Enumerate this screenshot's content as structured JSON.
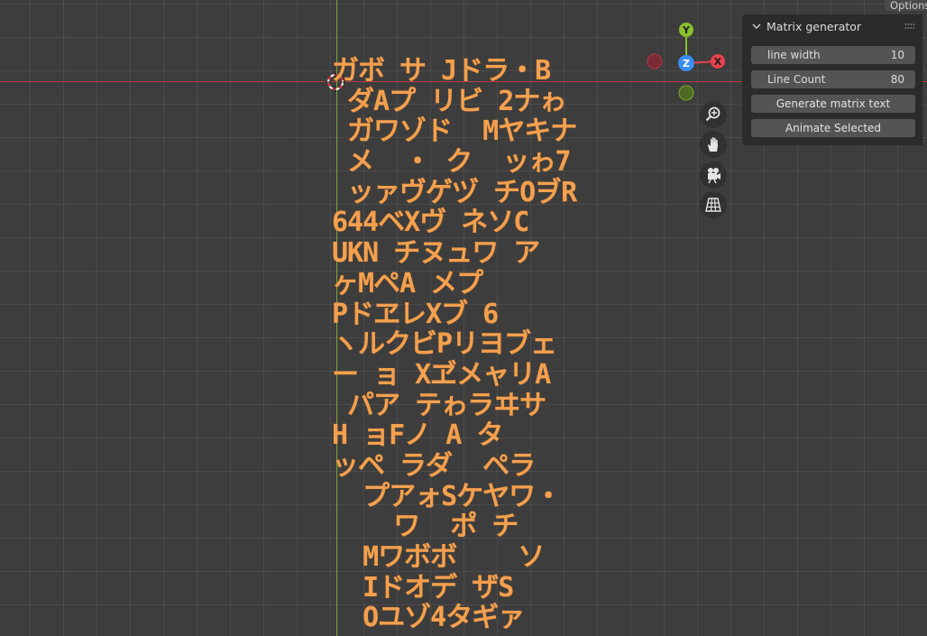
{
  "header": {
    "options_label": "Options"
  },
  "viewport": {
    "matrix_lines": [
      "ガボ サ Jドラ・B",
      " ダAプ リビ 2ナゎ",
      " ガワゾド  Mヤキナ",
      " メ  ・ ク  ッゎ7",
      " ッァヴゲヅ チOヺR",
      "644ベXヴ ネソC",
      "UKN チヌュワ ア",
      "ヶMペA メプ",
      "PドヱレXブ 6",
      "ヽルクビPリヨブェ",
      "ー ョ XヹメャリA",
      " パア テゎラヰサ",
      "H ョFノ A タ",
      "ッペ ラダ  ペラ",
      "  プアォSケヤワ・",
      "    ワ  ポ チ",
      "  Mワボボ    ソ",
      "  Iドオデ ザS",
      "  Oユゾ4タギァ"
    ],
    "gizmo": {
      "y_label": "Y",
      "z_label": "Z",
      "x_label": "X",
      "colors": {
        "x": "#e8424f",
        "y": "#8ac02c",
        "z": "#3a8ff0"
      }
    },
    "nav_icons": [
      "zoom-icon",
      "hand-pan-icon",
      "camera-icon",
      "perspective-grid-icon"
    ]
  },
  "sidebar": {
    "panel_title": "Matrix generator",
    "properties": [
      {
        "label": "line width",
        "value": "10"
      },
      {
        "label": "Line Count",
        "value": "80"
      }
    ],
    "buttons": [
      "Generate matrix text",
      "Animate Selected"
    ]
  }
}
